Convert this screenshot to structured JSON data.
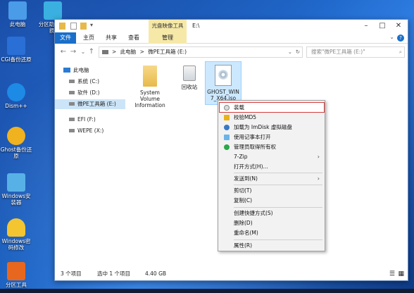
{
  "desktop": {
    "icons": [
      {
        "label": "此电脑",
        "icon": "computer-icon",
        "color": "#4a9be8"
      },
      {
        "label": "分区助手(无损)",
        "icon": "partition-icon",
        "color": "#3ab0e0"
      },
      {
        "label": "CGI备份还原",
        "icon": "backup-icon",
        "color": "#2a6fd6"
      },
      {
        "label": "Dism++",
        "icon": "gear-icon",
        "color": "#1d8ae6"
      },
      {
        "label": "Ghost备份还原",
        "icon": "ghost-icon",
        "color": "#f0b21f"
      },
      {
        "label": "Windows安装器",
        "icon": "installer-icon",
        "color": "#58b1e6"
      },
      {
        "label": "Windows密码修改",
        "icon": "key-icon",
        "color": "#f2c531"
      },
      {
        "label": "分区工具",
        "icon": "diskgenius-icon",
        "color": "#e8671e"
      }
    ]
  },
  "window": {
    "context_tab": "光盘映像工具",
    "title": "E:\\",
    "ribbon_tabs": [
      "文件",
      "主页",
      "共享",
      "查看",
      "管理"
    ],
    "address": {
      "segments": [
        "此电脑",
        "微PE工具箱 (E:)"
      ],
      "separator": ">"
    },
    "search_placeholder": "搜索\"微PE工具箱 (E:)\"",
    "nav": {
      "root": "此电脑",
      "items": [
        {
          "label": "系统 (C:)",
          "selected": false
        },
        {
          "label": "软件 (D:)",
          "selected": false
        },
        {
          "label": "微PE工具箱 (E:)",
          "selected": true
        },
        {
          "label": "EFI (F:)",
          "selected": false
        },
        {
          "label": "WEPE (X:)",
          "selected": false
        }
      ]
    },
    "files": [
      {
        "name": "System Volume Information",
        "type": "folder",
        "selected": false
      },
      {
        "name": "回收站",
        "type": "recycle-bin",
        "selected": false
      },
      {
        "name": "GHOST_WIN7_X64.iso",
        "type": "iso",
        "selected": true
      }
    ],
    "status": {
      "count": "3 个项目",
      "selected": "选中 1 个项目",
      "size": "4.40 GB"
    }
  },
  "context_menu": {
    "items": [
      {
        "label": "装载",
        "icon": "disc-icon",
        "color": "#dcdcdc",
        "highlighted": true
      },
      {
        "label": "校验MD5",
        "icon": "shield-icon",
        "color": "#e8b21a"
      },
      {
        "label": "加载为 ImDisk 虚拟磁盘",
        "icon": "imdisk-icon",
        "color": "#3a78c4"
      },
      {
        "label": "使用记事本打开",
        "icon": "notepad-icon",
        "color": "#6cb4e8"
      },
      {
        "label": "管理员取得所有权",
        "icon": "admin-shield-icon",
        "color": "#2aa84a"
      },
      {
        "label": "7-Zip",
        "submenu": true
      },
      {
        "label": "打开方式(H)..."
      },
      {
        "separator": true
      },
      {
        "label": "发送到(N)",
        "submenu": true
      },
      {
        "separator": true
      },
      {
        "label": "剪切(T)"
      },
      {
        "label": "复制(C)"
      },
      {
        "separator": true
      },
      {
        "label": "创建快捷方式(S)"
      },
      {
        "label": "删除(D)"
      },
      {
        "label": "重命名(M)"
      },
      {
        "separator": true
      },
      {
        "label": "属性(R)"
      }
    ]
  },
  "colors": {
    "accent": "#1a6fc9",
    "context_tab": "#f6e9a8",
    "selection": "#cce8ff",
    "highlight_box": "#d63c3c"
  }
}
